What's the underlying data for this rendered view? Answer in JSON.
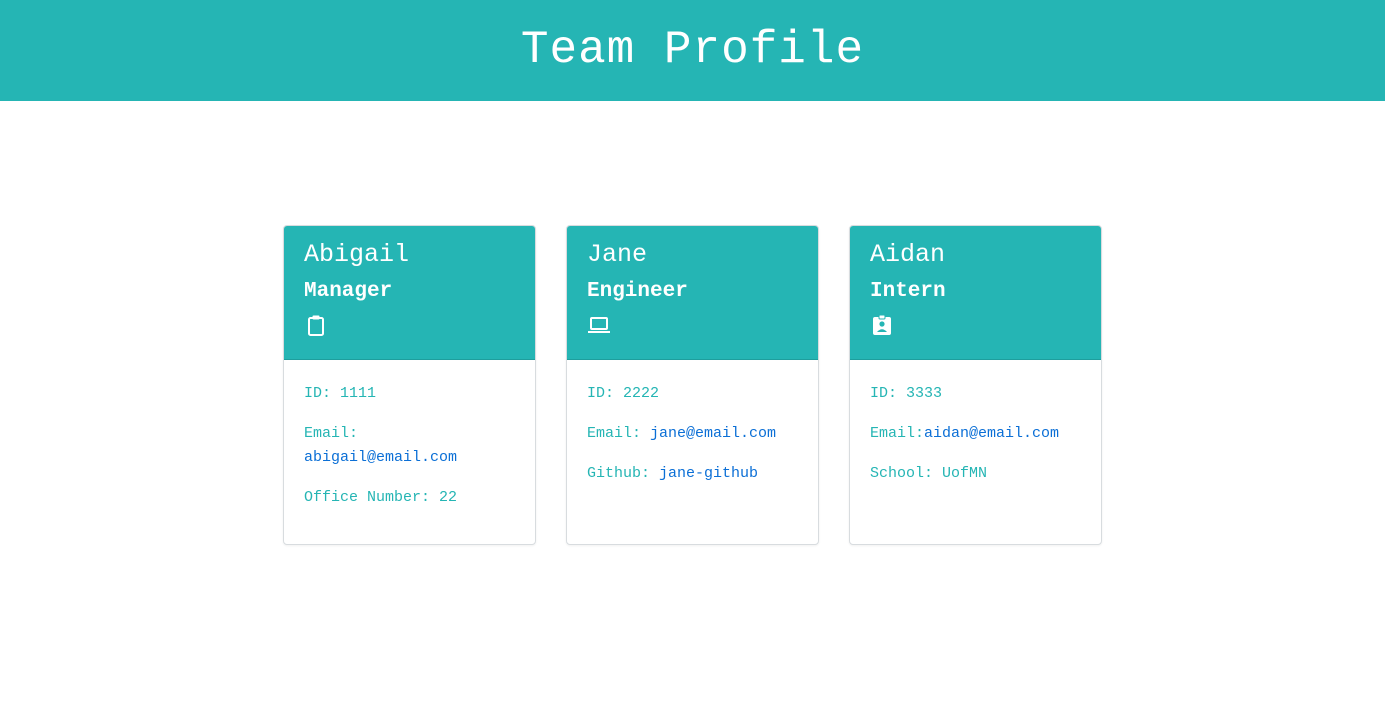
{
  "header": {
    "title": "Team Profile"
  },
  "colors": {
    "accent": "#25b5b4",
    "link": "#0b6fd6",
    "background": "#ffffff"
  },
  "team": [
    {
      "name": "Abigail",
      "role": "Manager",
      "icon": "clipboard-icon",
      "id_text": "ID: 1111",
      "email_label": "Email:",
      "email": "abigail@email.com",
      "extra_text": "Office Number: 22"
    },
    {
      "name": "Jane",
      "role": "Engineer",
      "icon": "laptop-icon",
      "id_text": "ID: 2222",
      "email_label": "Email: ",
      "email": "jane@email.com",
      "extra_label": "Github: ",
      "github": "jane-github"
    },
    {
      "name": "Aidan",
      "role": "Intern",
      "icon": "id-badge-icon",
      "id_text": "ID: 3333",
      "email_label": "Email:",
      "email": "aidan@email.com",
      "extra_text": "School: UofMN"
    }
  ]
}
